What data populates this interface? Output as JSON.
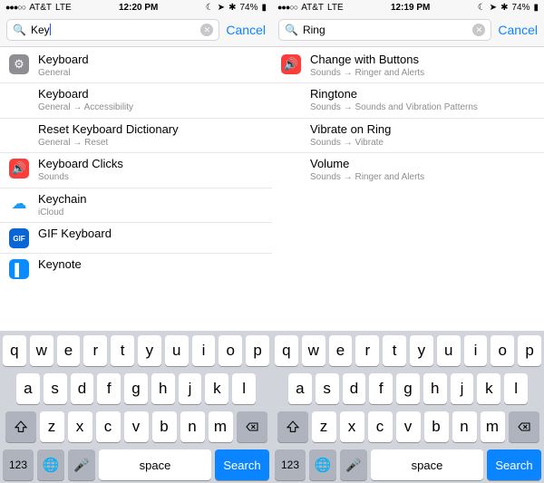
{
  "icons": {
    "gear": "⚙",
    "sound": "🔊",
    "cloud": "☁",
    "gif": "GIF",
    "keynote": "▌"
  },
  "phones": [
    {
      "status": {
        "signal": "●●●○○",
        "carrier": "AT&T",
        "net": "LTE",
        "time": "12:20 PM",
        "nav": "↖",
        "loc": "✈",
        "bt": "⚡",
        "batt": "74%",
        "battIcon": "▮"
      },
      "search": {
        "text": "Key",
        "cancel": "Cancel",
        "hasCursor": true
      },
      "results": [
        {
          "iconKey": "gear",
          "iconClass": "ic-general",
          "title": "Keyboard",
          "sub": "General"
        },
        {
          "iconKey": "",
          "iconClass": "placeholder",
          "title": "Keyboard",
          "sub": "General → Accessibility"
        },
        {
          "iconKey": "",
          "iconClass": "placeholder",
          "title": "Reset Keyboard Dictionary",
          "sub": "General → Reset"
        },
        {
          "iconKey": "sound",
          "iconClass": "ic-sounds",
          "title": "Keyboard Clicks",
          "sub": "Sounds"
        },
        {
          "iconKey": "cloud",
          "iconClass": "ic-icloud",
          "title": "Keychain",
          "sub": "iCloud"
        },
        {
          "iconKey": "gif",
          "iconClass": "ic-gif",
          "title": "GIF Keyboard",
          "sub": ""
        },
        {
          "iconKey": "keynote",
          "iconClass": "ic-keynote",
          "title": "Keynote",
          "sub": ""
        }
      ]
    },
    {
      "status": {
        "signal": "●●●○○",
        "carrier": "AT&T",
        "net": "LTE",
        "time": "12:19 PM",
        "nav": "↖",
        "loc": "✈",
        "bt": "⚡",
        "batt": "74%",
        "battIcon": "▮"
      },
      "search": {
        "text": "Ring",
        "cancel": "Cancel",
        "hasCursor": false
      },
      "results": [
        {
          "iconKey": "sound",
          "iconClass": "ic-sounds",
          "title": "Change with Buttons",
          "sub": "Sounds → Ringer and Alerts"
        },
        {
          "iconKey": "",
          "iconClass": "placeholder",
          "title": "Ringtone",
          "sub": "Sounds → Sounds and Vibration Patterns"
        },
        {
          "iconKey": "",
          "iconClass": "placeholder",
          "title": "Vibrate on Ring",
          "sub": "Sounds → Vibrate"
        },
        {
          "iconKey": "",
          "iconClass": "placeholder",
          "title": "Volume",
          "sub": "Sounds → Ringer and Alerts"
        }
      ]
    }
  ],
  "keyboard": {
    "row1": [
      "q",
      "w",
      "e",
      "r",
      "t",
      "y",
      "u",
      "i",
      "o",
      "p"
    ],
    "row2": [
      "a",
      "s",
      "d",
      "f",
      "g",
      "h",
      "j",
      "k",
      "l"
    ],
    "row3": [
      "z",
      "x",
      "c",
      "v",
      "b",
      "n",
      "m"
    ],
    "k123": "123",
    "space": "space",
    "search": "Search"
  }
}
